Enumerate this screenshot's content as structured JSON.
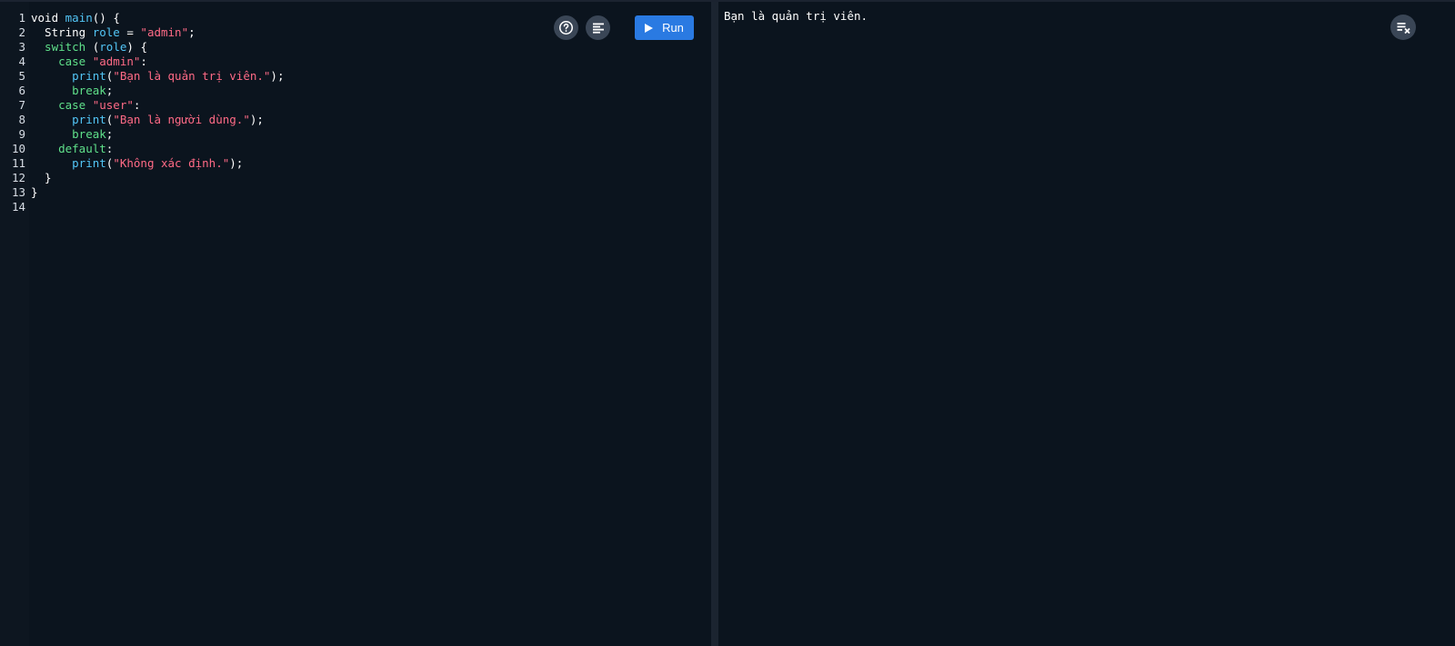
{
  "editor": {
    "line_numbers": [
      "1",
      "2",
      "3",
      "4",
      "5",
      "6",
      "7",
      "8",
      "9",
      "10",
      "11",
      "12",
      "13",
      "14"
    ],
    "lines": [
      [
        {
          "t": "void ",
          "c": "kw"
        },
        {
          "t": "main",
          "c": "fn"
        },
        {
          "t": "() {",
          "c": "plain"
        }
      ],
      [
        {
          "t": "  String ",
          "c": "type"
        },
        {
          "t": "role",
          "c": "var"
        },
        {
          "t": " = ",
          "c": "plain"
        },
        {
          "t": "\"admin\"",
          "c": "str"
        },
        {
          "t": ";",
          "c": "plain"
        }
      ],
      [
        {
          "t": "  switch",
          "c": "ctl"
        },
        {
          "t": " (",
          "c": "plain"
        },
        {
          "t": "role",
          "c": "var"
        },
        {
          "t": ") {",
          "c": "plain"
        }
      ],
      [
        {
          "t": "    case ",
          "c": "ctl"
        },
        {
          "t": "\"admin\"",
          "c": "str"
        },
        {
          "t": ":",
          "c": "plain"
        }
      ],
      [
        {
          "t": "      print",
          "c": "fn"
        },
        {
          "t": "(",
          "c": "plain"
        },
        {
          "t": "\"Bạn là quản trị viên.\"",
          "c": "str"
        },
        {
          "t": ");",
          "c": "plain"
        }
      ],
      [
        {
          "t": "      break",
          "c": "ctl"
        },
        {
          "t": ";",
          "c": "plain"
        }
      ],
      [
        {
          "t": "    case ",
          "c": "ctl"
        },
        {
          "t": "\"user\"",
          "c": "str"
        },
        {
          "t": ":",
          "c": "plain"
        }
      ],
      [
        {
          "t": "      print",
          "c": "fn"
        },
        {
          "t": "(",
          "c": "plain"
        },
        {
          "t": "\"Bạn là người dùng.\"",
          "c": "str"
        },
        {
          "t": ");",
          "c": "plain"
        }
      ],
      [
        {
          "t": "      break",
          "c": "ctl"
        },
        {
          "t": ";",
          "c": "plain"
        }
      ],
      [
        {
          "t": "    default",
          "c": "ctl"
        },
        {
          "t": ":",
          "c": "plain"
        }
      ],
      [
        {
          "t": "      print",
          "c": "fn"
        },
        {
          "t": "(",
          "c": "plain"
        },
        {
          "t": "\"Không xác định.\"",
          "c": "str"
        },
        {
          "t": ");",
          "c": "plain"
        }
      ],
      [
        {
          "t": "  }",
          "c": "plain"
        }
      ],
      [
        {
          "t": "}",
          "c": "plain"
        }
      ],
      [
        {
          "t": "",
          "c": "plain"
        }
      ]
    ]
  },
  "toolbar": {
    "help_icon": "help-circle-icon",
    "format_icon": "format-align-icon",
    "run_label": "Run",
    "run_icon": "play-icon"
  },
  "output": {
    "text": "Bạn là quản trị viên.",
    "clear_icon": "clear-output-icon"
  },
  "colors": {
    "background": "#0b141e",
    "keyword": "#ffffff",
    "function": "#53c6f7",
    "string": "#ff6a86",
    "control": "#5fe08a",
    "run_button": "#2a7ae2",
    "icon_button": "#3a4656"
  }
}
